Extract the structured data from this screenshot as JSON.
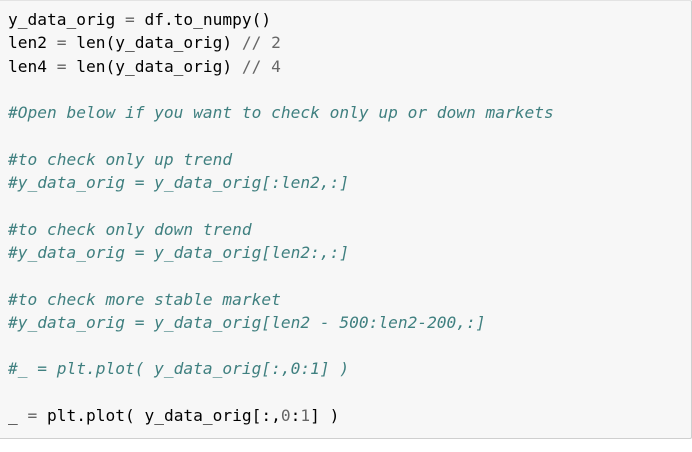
{
  "cell": {
    "lines": [
      {
        "kind": "code",
        "parts": [
          [
            "t",
            "y_data_orig "
          ],
          [
            "o",
            "="
          ],
          [
            "t",
            " df.to_numpy()"
          ]
        ]
      },
      {
        "kind": "code",
        "parts": [
          [
            "t",
            "len2 "
          ],
          [
            "o",
            "="
          ],
          [
            "t",
            " len(y_data_orig) "
          ],
          [
            "o",
            "//"
          ],
          [
            "t",
            " "
          ],
          [
            "n",
            "2"
          ]
        ]
      },
      {
        "kind": "code",
        "parts": [
          [
            "t",
            "len4 "
          ],
          [
            "o",
            "="
          ],
          [
            "t",
            " len(y_data_orig) "
          ],
          [
            "o",
            "//"
          ],
          [
            "t",
            " "
          ],
          [
            "n",
            "4"
          ]
        ]
      },
      {
        "kind": "blank",
        "parts": []
      },
      {
        "kind": "comment",
        "parts": [
          [
            "c",
            "#Open below if you want to check only up or down markets"
          ]
        ]
      },
      {
        "kind": "blank",
        "parts": []
      },
      {
        "kind": "comment",
        "parts": [
          [
            "c",
            "#to check only up trend"
          ]
        ]
      },
      {
        "kind": "comment",
        "parts": [
          [
            "c",
            "#y_data_orig = y_data_orig[:len2,:]"
          ]
        ]
      },
      {
        "kind": "blank",
        "parts": []
      },
      {
        "kind": "comment",
        "parts": [
          [
            "c",
            "#to check only down trend"
          ]
        ]
      },
      {
        "kind": "comment",
        "parts": [
          [
            "c",
            "#y_data_orig = y_data_orig[len2:,:]"
          ]
        ]
      },
      {
        "kind": "blank",
        "parts": []
      },
      {
        "kind": "comment",
        "parts": [
          [
            "c",
            "#to check more stable market"
          ]
        ]
      },
      {
        "kind": "comment",
        "parts": [
          [
            "c",
            "#y_data_orig = y_data_orig[len2 - 500:len2-200,:]"
          ]
        ]
      },
      {
        "kind": "blank",
        "parts": []
      },
      {
        "kind": "comment",
        "parts": [
          [
            "c",
            "#_ = plt.plot( y_data_orig[:,0:1] )"
          ]
        ]
      },
      {
        "kind": "blank",
        "parts": []
      },
      {
        "kind": "code",
        "parts": [
          [
            "t",
            "_ "
          ],
          [
            "o",
            "="
          ],
          [
            "t",
            " plt.plot( y_data_orig[:,"
          ],
          [
            "n",
            "0"
          ],
          [
            "t",
            ":"
          ],
          [
            "n",
            "1"
          ],
          [
            "t",
            "] )"
          ]
        ]
      }
    ]
  }
}
